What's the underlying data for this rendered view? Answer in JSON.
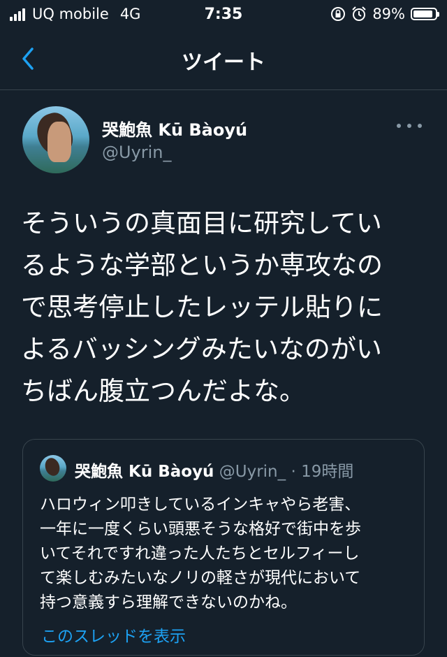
{
  "status_bar": {
    "carrier": "UQ mobile",
    "network": "4G",
    "time": "7:35",
    "battery": "89%",
    "battery_level": 0.89,
    "icons": [
      "signal-bars-icon",
      "rotation-lock-icon",
      "alarm-icon",
      "battery-icon"
    ]
  },
  "nav": {
    "title": "ツイート",
    "back_icon": "chevron-left-icon",
    "accent": "#1da1f2"
  },
  "tweet": {
    "display_name": "哭鮑魚 Kū Bàoyú",
    "handle": "@Uyrin_",
    "more_icon": "more-dots-icon",
    "text": "そういうの真面目に研究してい\nるような学部というか専攻なの\nで思考停止したレッテル貼りに\nよるバッシングみたいなのがい\nちばん腹立つんだよな。"
  },
  "quote": {
    "display_name": "哭鮑魚 Kū Bàoyú",
    "handle": "@Uyrin_",
    "separator": "·",
    "time": "19時間",
    "text": "ハロウィン叩きしているインキャやら老害、\n一年に一度くらい頭悪そうな格好で街中を歩\nいてそれですれ違った人たちとセルフィーし\nて楽しむみたいなノリの軽さが現代において\n持つ意義すら理解できないのかね。",
    "show_thread": "このスレッドを表示"
  },
  "colors": {
    "background": "#15202b",
    "border": "#38444d",
    "secondary_text": "#8899a6",
    "link": "#1da1f2"
  }
}
